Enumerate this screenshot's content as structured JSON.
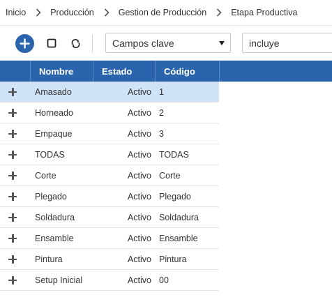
{
  "breadcrumb": {
    "items": [
      "Inicio",
      "Producción",
      "Gestion de Producción",
      "Etapa Productiva"
    ]
  },
  "toolbar": {
    "icons": [
      "add-circle-icon",
      "square-icon",
      "refresh-icon"
    ],
    "select_value": "Campos clave",
    "input_value": "incluye"
  },
  "colors": {
    "header_bg": "#2a64ac",
    "selected_row": "#cfe3f6",
    "add_button": "#2a64ac"
  },
  "grid": {
    "columns": [
      "Nombre",
      "Estado",
      "Código"
    ],
    "rows": [
      {
        "nombre": "Amasado",
        "estado": "Activo",
        "codigo": "1"
      },
      {
        "nombre": "Horneado",
        "estado": "Activo",
        "codigo": "2"
      },
      {
        "nombre": "Empaque",
        "estado": "Activo",
        "codigo": "3"
      },
      {
        "nombre": "TODAS",
        "estado": "Activo",
        "codigo": "TODAS"
      },
      {
        "nombre": "Corte",
        "estado": "Activo",
        "codigo": "Corte"
      },
      {
        "nombre": "Plegado",
        "estado": "Activo",
        "codigo": "Plegado"
      },
      {
        "nombre": "Soldadura",
        "estado": "Activo",
        "codigo": "Soldadura"
      },
      {
        "nombre": "Ensamble",
        "estado": "Activo",
        "codigo": "Ensamble"
      },
      {
        "nombre": "Pintura",
        "estado": "Activo",
        "codigo": "Pintura"
      },
      {
        "nombre": "Setup Inicial",
        "estado": "Activo",
        "codigo": "00"
      }
    ],
    "selected_row": 0
  }
}
